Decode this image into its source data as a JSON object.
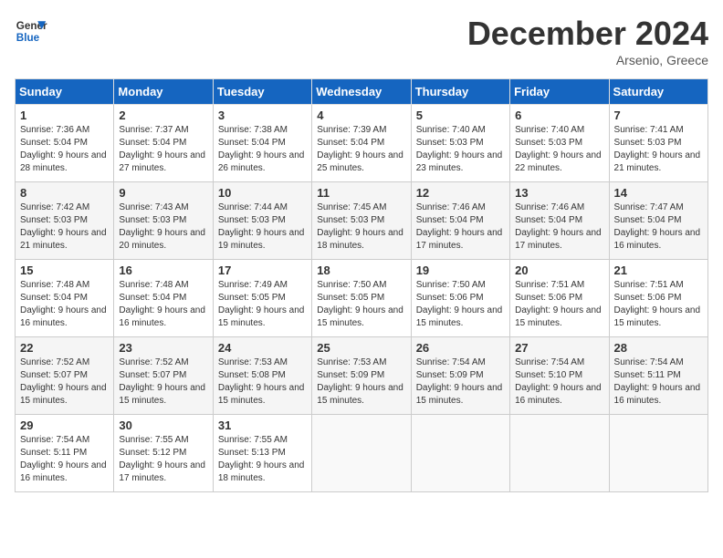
{
  "logo": {
    "line1": "General",
    "line2": "Blue"
  },
  "title": "December 2024",
  "location": "Arsenio, Greece",
  "days_header": [
    "Sunday",
    "Monday",
    "Tuesday",
    "Wednesday",
    "Thursday",
    "Friday",
    "Saturday"
  ],
  "weeks": [
    [
      {
        "day": "1",
        "sunrise": "Sunrise: 7:36 AM",
        "sunset": "Sunset: 5:04 PM",
        "daylight": "Daylight: 9 hours and 28 minutes."
      },
      {
        "day": "2",
        "sunrise": "Sunrise: 7:37 AM",
        "sunset": "Sunset: 5:04 PM",
        "daylight": "Daylight: 9 hours and 27 minutes."
      },
      {
        "day": "3",
        "sunrise": "Sunrise: 7:38 AM",
        "sunset": "Sunset: 5:04 PM",
        "daylight": "Daylight: 9 hours and 26 minutes."
      },
      {
        "day": "4",
        "sunrise": "Sunrise: 7:39 AM",
        "sunset": "Sunset: 5:04 PM",
        "daylight": "Daylight: 9 hours and 25 minutes."
      },
      {
        "day": "5",
        "sunrise": "Sunrise: 7:40 AM",
        "sunset": "Sunset: 5:03 PM",
        "daylight": "Daylight: 9 hours and 23 minutes."
      },
      {
        "day": "6",
        "sunrise": "Sunrise: 7:40 AM",
        "sunset": "Sunset: 5:03 PM",
        "daylight": "Daylight: 9 hours and 22 minutes."
      },
      {
        "day": "7",
        "sunrise": "Sunrise: 7:41 AM",
        "sunset": "Sunset: 5:03 PM",
        "daylight": "Daylight: 9 hours and 21 minutes."
      }
    ],
    [
      {
        "day": "8",
        "sunrise": "Sunrise: 7:42 AM",
        "sunset": "Sunset: 5:03 PM",
        "daylight": "Daylight: 9 hours and 21 minutes."
      },
      {
        "day": "9",
        "sunrise": "Sunrise: 7:43 AM",
        "sunset": "Sunset: 5:03 PM",
        "daylight": "Daylight: 9 hours and 20 minutes."
      },
      {
        "day": "10",
        "sunrise": "Sunrise: 7:44 AM",
        "sunset": "Sunset: 5:03 PM",
        "daylight": "Daylight: 9 hours and 19 minutes."
      },
      {
        "day": "11",
        "sunrise": "Sunrise: 7:45 AM",
        "sunset": "Sunset: 5:03 PM",
        "daylight": "Daylight: 9 hours and 18 minutes."
      },
      {
        "day": "12",
        "sunrise": "Sunrise: 7:46 AM",
        "sunset": "Sunset: 5:04 PM",
        "daylight": "Daylight: 9 hours and 17 minutes."
      },
      {
        "day": "13",
        "sunrise": "Sunrise: 7:46 AM",
        "sunset": "Sunset: 5:04 PM",
        "daylight": "Daylight: 9 hours and 17 minutes."
      },
      {
        "day": "14",
        "sunrise": "Sunrise: 7:47 AM",
        "sunset": "Sunset: 5:04 PM",
        "daylight": "Daylight: 9 hours and 16 minutes."
      }
    ],
    [
      {
        "day": "15",
        "sunrise": "Sunrise: 7:48 AM",
        "sunset": "Sunset: 5:04 PM",
        "daylight": "Daylight: 9 hours and 16 minutes."
      },
      {
        "day": "16",
        "sunrise": "Sunrise: 7:48 AM",
        "sunset": "Sunset: 5:04 PM",
        "daylight": "Daylight: 9 hours and 16 minutes."
      },
      {
        "day": "17",
        "sunrise": "Sunrise: 7:49 AM",
        "sunset": "Sunset: 5:05 PM",
        "daylight": "Daylight: 9 hours and 15 minutes."
      },
      {
        "day": "18",
        "sunrise": "Sunrise: 7:50 AM",
        "sunset": "Sunset: 5:05 PM",
        "daylight": "Daylight: 9 hours and 15 minutes."
      },
      {
        "day": "19",
        "sunrise": "Sunrise: 7:50 AM",
        "sunset": "Sunset: 5:06 PM",
        "daylight": "Daylight: 9 hours and 15 minutes."
      },
      {
        "day": "20",
        "sunrise": "Sunrise: 7:51 AM",
        "sunset": "Sunset: 5:06 PM",
        "daylight": "Daylight: 9 hours and 15 minutes."
      },
      {
        "day": "21",
        "sunrise": "Sunrise: 7:51 AM",
        "sunset": "Sunset: 5:06 PM",
        "daylight": "Daylight: 9 hours and 15 minutes."
      }
    ],
    [
      {
        "day": "22",
        "sunrise": "Sunrise: 7:52 AM",
        "sunset": "Sunset: 5:07 PM",
        "daylight": "Daylight: 9 hours and 15 minutes."
      },
      {
        "day": "23",
        "sunrise": "Sunrise: 7:52 AM",
        "sunset": "Sunset: 5:07 PM",
        "daylight": "Daylight: 9 hours and 15 minutes."
      },
      {
        "day": "24",
        "sunrise": "Sunrise: 7:53 AM",
        "sunset": "Sunset: 5:08 PM",
        "daylight": "Daylight: 9 hours and 15 minutes."
      },
      {
        "day": "25",
        "sunrise": "Sunrise: 7:53 AM",
        "sunset": "Sunset: 5:09 PM",
        "daylight": "Daylight: 9 hours and 15 minutes."
      },
      {
        "day": "26",
        "sunrise": "Sunrise: 7:54 AM",
        "sunset": "Sunset: 5:09 PM",
        "daylight": "Daylight: 9 hours and 15 minutes."
      },
      {
        "day": "27",
        "sunrise": "Sunrise: 7:54 AM",
        "sunset": "Sunset: 5:10 PM",
        "daylight": "Daylight: 9 hours and 16 minutes."
      },
      {
        "day": "28",
        "sunrise": "Sunrise: 7:54 AM",
        "sunset": "Sunset: 5:11 PM",
        "daylight": "Daylight: 9 hours and 16 minutes."
      }
    ],
    [
      {
        "day": "29",
        "sunrise": "Sunrise: 7:54 AM",
        "sunset": "Sunset: 5:11 PM",
        "daylight": "Daylight: 9 hours and 16 minutes."
      },
      {
        "day": "30",
        "sunrise": "Sunrise: 7:55 AM",
        "sunset": "Sunset: 5:12 PM",
        "daylight": "Daylight: 9 hours and 17 minutes."
      },
      {
        "day": "31",
        "sunrise": "Sunrise: 7:55 AM",
        "sunset": "Sunset: 5:13 PM",
        "daylight": "Daylight: 9 hours and 18 minutes."
      },
      null,
      null,
      null,
      null
    ]
  ]
}
